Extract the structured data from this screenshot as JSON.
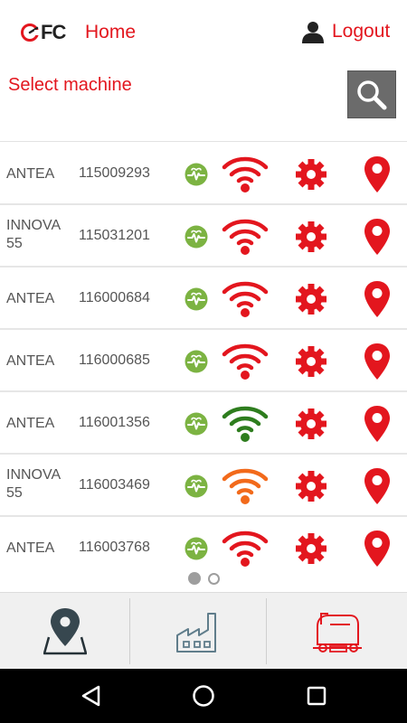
{
  "header": {
    "logo_text": "FC",
    "home_label": "Home",
    "logout_label": "Logout"
  },
  "page": {
    "title": "Select machine"
  },
  "machines": [
    {
      "model": "ANTEA",
      "serial": "115009293",
      "signal": "red"
    },
    {
      "model": "INNOVA 55",
      "serial": "115031201",
      "signal": "red"
    },
    {
      "model": "ANTEA",
      "serial": "116000684",
      "signal": "red"
    },
    {
      "model": "ANTEA",
      "serial": "116000685",
      "signal": "red"
    },
    {
      "model": "ANTEA",
      "serial": "116001356",
      "signal": "green"
    },
    {
      "model": "INNOVA 55",
      "serial": "116003469",
      "signal": "orange"
    },
    {
      "model": "ANTEA",
      "serial": "116003768",
      "signal": "red"
    }
  ],
  "pager": {
    "current": 1,
    "total": 2
  },
  "tabs": [
    {
      "icon": "map-pin-icon",
      "active": true
    },
    {
      "icon": "factory-icon",
      "active": false
    },
    {
      "icon": "scrubber-machine-icon",
      "active": false
    }
  ],
  "colors": {
    "accent": "#e3161e",
    "health": "#7cb342",
    "signal_red": "#e3161e",
    "signal_green": "#2e7d1e",
    "signal_orange": "#f26a1b",
    "search_bg": "#6b6b6b"
  },
  "icons": {
    "health": "heartbeat-icon",
    "signal": "wifi-signal-icon",
    "settings": "gear-icon",
    "location": "location-pin-icon"
  }
}
